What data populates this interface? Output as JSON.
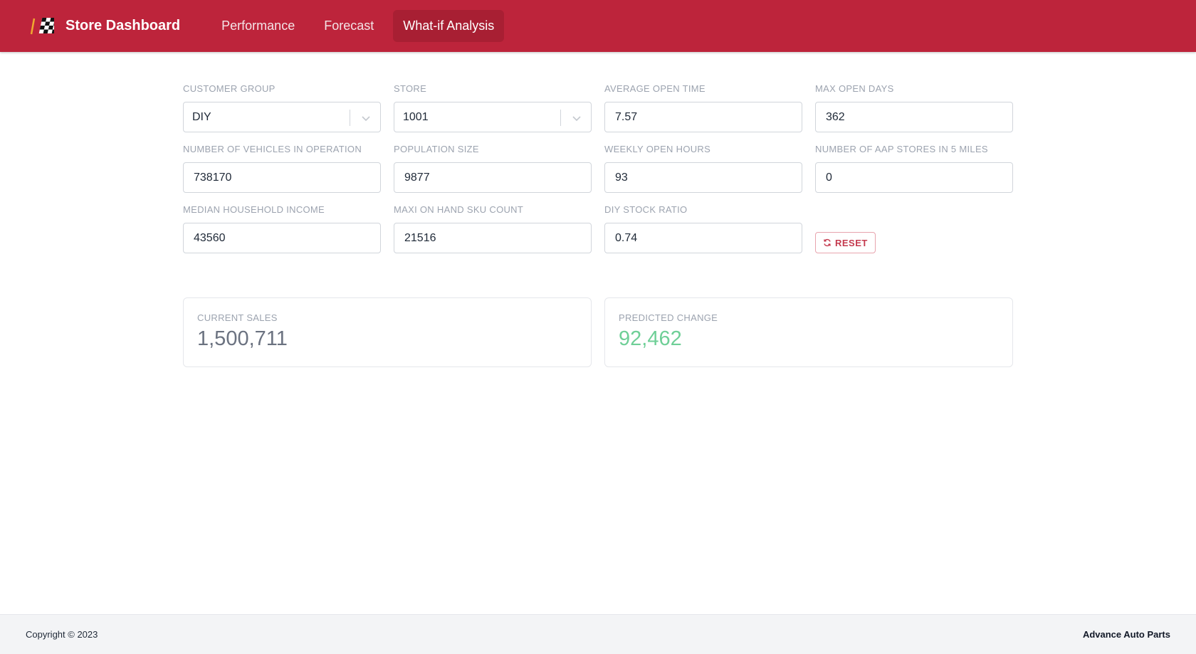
{
  "header": {
    "logo_icon": "checkered-flag-icon",
    "title": "Store Dashboard",
    "nav": [
      {
        "label": "Performance",
        "active": false
      },
      {
        "label": "Forecast",
        "active": false
      },
      {
        "label": "What-if Analysis",
        "active": true
      }
    ],
    "brand_color": "#bd243b"
  },
  "form": {
    "customer_group": {
      "label": "CUSTOMER GROUP",
      "value": "DIY"
    },
    "store": {
      "label": "STORE",
      "value": "1001"
    },
    "average_open_time": {
      "label": "AVERAGE OPEN TIME",
      "value": "7.57"
    },
    "max_open_days": {
      "label": "MAX OPEN DAYS",
      "value": "362"
    },
    "vehicles_in_operation": {
      "label": "NUMBER OF VEHICLES IN OPERATION",
      "value": "738170"
    },
    "population_size": {
      "label": "POPULATION SIZE",
      "value": "9877"
    },
    "weekly_open_hours": {
      "label": "WEEKLY OPEN HOURS",
      "value": "93"
    },
    "aap_stores_5_miles": {
      "label": "NUMBER OF AAP STORES IN 5 MILES",
      "value": "0"
    },
    "median_household_income": {
      "label": "MEDIAN HOUSEHOLD INCOME",
      "value": "43560"
    },
    "maxi_on_hand_sku_count": {
      "label": "MAXI ON HAND SKU COUNT",
      "value": "21516"
    },
    "diy_stock_ratio": {
      "label": "DIY STOCK RATIO",
      "value": "0.74"
    },
    "reset_label": "RESET",
    "reset_icon": "refresh-icon"
  },
  "results": {
    "current_sales": {
      "label": "CURRENT SALES",
      "value": "1,500,711"
    },
    "predicted_change": {
      "label": "PREDICTED CHANGE",
      "value": "92,462",
      "color": "#6fcf97"
    }
  },
  "footer": {
    "copyright": "Copyright © 2023",
    "company": "Advance Auto Parts"
  }
}
